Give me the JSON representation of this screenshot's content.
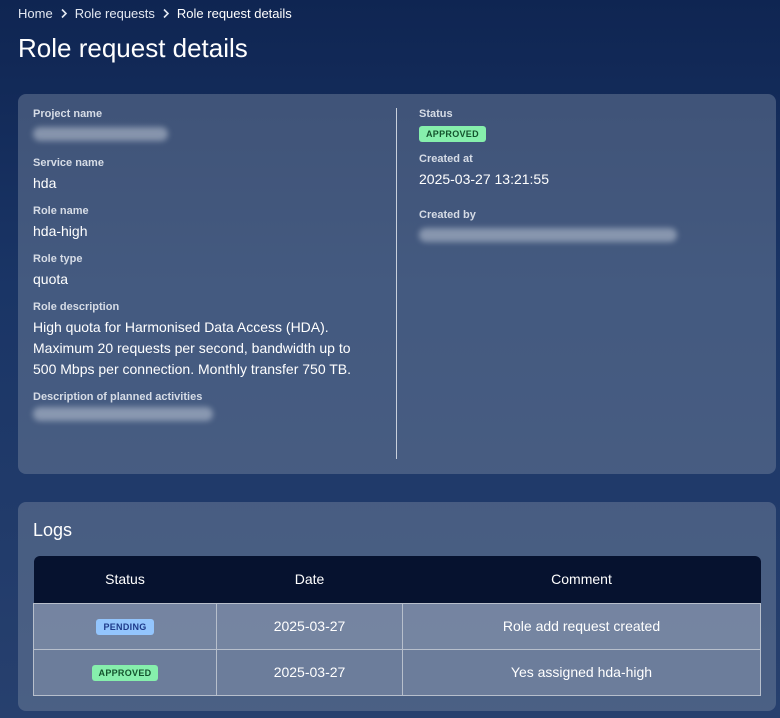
{
  "breadcrumb": {
    "home": "Home",
    "role_requests": "Role requests",
    "current": "Role request details"
  },
  "page_title": "Role request details",
  "details": {
    "project_name": {
      "label": "Project name"
    },
    "service_name": {
      "label": "Service name",
      "value": "hda"
    },
    "role_name": {
      "label": "Role name",
      "value": "hda-high"
    },
    "role_type": {
      "label": "Role type",
      "value": "quota"
    },
    "role_description": {
      "label": "Role description",
      "value": "High quota for Harmonised Data Access (HDA). Maximum 20 requests per second, bandwidth up to 500 Mbps per connection. Monthly transfer 750 TB."
    },
    "planned_activities": {
      "label": "Description of planned activities"
    },
    "status": {
      "label": "Status",
      "value": "APPROVED"
    },
    "created_at": {
      "label": "Created at",
      "value": "2025-03-27 13:21:55"
    },
    "created_by": {
      "label": "Created by"
    }
  },
  "logs": {
    "title": "Logs",
    "columns": [
      "Status",
      "Date",
      "Comment"
    ],
    "rows": [
      {
        "status": "PENDING",
        "date": "2025-03-27",
        "comment": "Role add request created"
      },
      {
        "status": "APPROVED",
        "date": "2025-03-27",
        "comment": "Yes assigned hda-high"
      }
    ]
  },
  "colors": {
    "approved_badge": "#86efac",
    "pending_badge": "#93c5fd",
    "table_header": "#06122f"
  },
  "icons": {
    "breadcrumb_separator": "chevron-right-icon"
  }
}
